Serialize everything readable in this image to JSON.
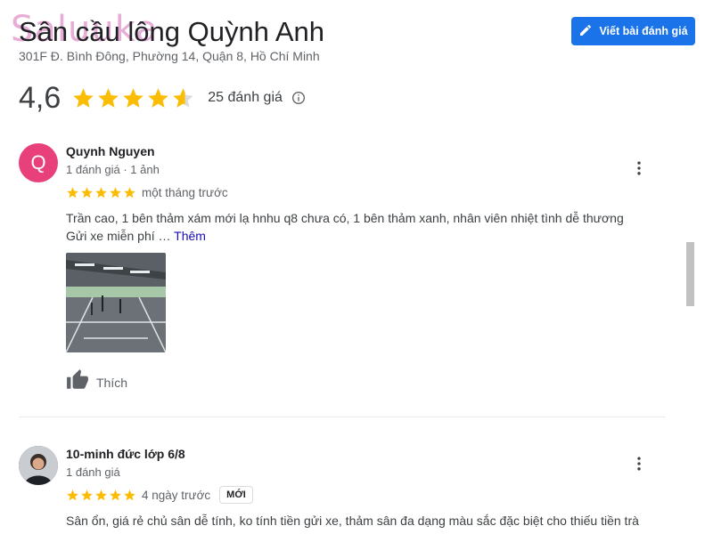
{
  "watermark": "Saluuka",
  "place": {
    "name": "Sân cầu lông Quỳnh Anh",
    "address": "301F Đ. Bình Đông, Phường 14, Quận 8, Hồ Chí Minh"
  },
  "write_review_label": "Viết bài đánh giá",
  "rating": {
    "value": "4,6",
    "stars": 4.6,
    "count_label": "25 đánh giá"
  },
  "colors": {
    "accent": "#1a73e8",
    "star": "#fbbc04",
    "avatar_q": "#e8407a"
  },
  "reviews": [
    {
      "avatar_letter": "Q",
      "author": "Quynh Nguyen",
      "meta": "1 đánh giá · 1 ảnh",
      "stars": 5,
      "time": "một tháng trước",
      "text_line1": "Trần cao, 1 bên thảm xám mới lạ hnhu q8 chưa có, 1 bên thảm xanh, nhân viên nhiệt tình dễ thương",
      "text_line2": "Gửi xe miễn phí …",
      "more_label": "Thêm",
      "like_label": "Thích"
    },
    {
      "author": "10-minh đức lớp 6/8",
      "meta": "1 đánh giá",
      "stars": 5,
      "time": "4 ngày trước",
      "badge": "MỚI",
      "text_line1": "Sân ổn, giá rẻ chủ sân dễ tính, ko tính tiền gửi xe, thảm sân đa dạng màu sắc đặc biệt cho thiếu tiền trà"
    }
  ]
}
